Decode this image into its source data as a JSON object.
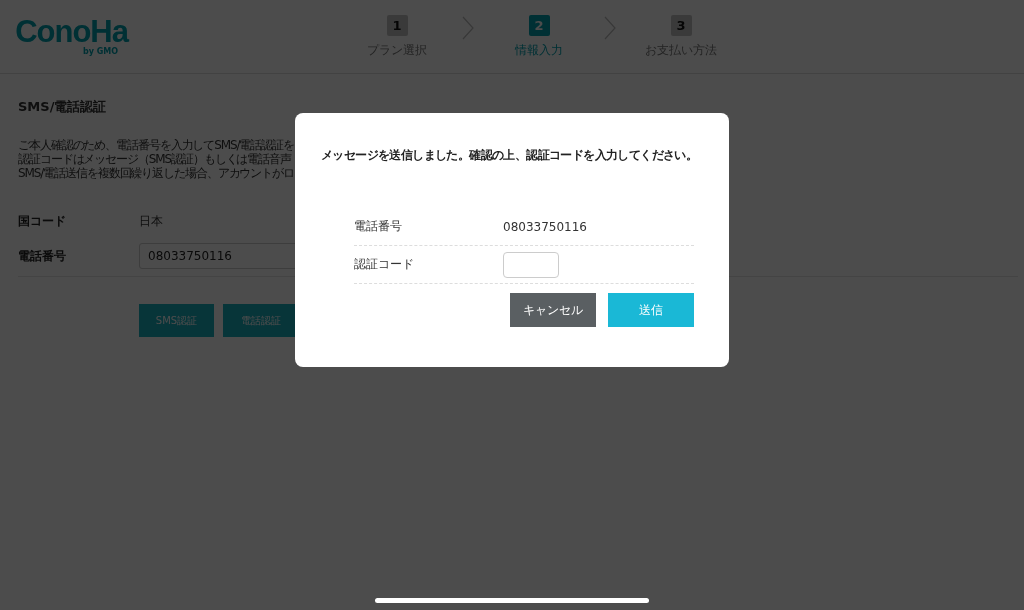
{
  "logo": {
    "name": "ConoHa",
    "byline": "by GMO"
  },
  "steps": [
    {
      "number": "1",
      "label": "プラン選択",
      "selected": false
    },
    {
      "number": "2",
      "label": "情報入力",
      "selected": true
    },
    {
      "number": "3",
      "label": "お支払い方法",
      "selected": false
    }
  ],
  "section": {
    "title": "SMS/電話認証",
    "description": [
      "ご本人確認のため、電話番号を入力してSMS/電話認証を",
      "認証コードはメッセージ（SMS認証）もしくは電話音声",
      "SMS/電話送信を複数回繰り返した場合、アカウントがロ"
    ],
    "fields": [
      {
        "label": "国コード",
        "value": "日本",
        "kind": "text"
      },
      {
        "label": "電話番号",
        "value": "08033750116",
        "kind": "input"
      }
    ],
    "buttons": [
      "SMS認証",
      "電話認証"
    ]
  },
  "dialog": {
    "message": "メッセージを送信しました。確認の上、認証コードを入力してください。",
    "rows": [
      {
        "label": "電話番号",
        "value": "08033750116",
        "kind": "text"
      },
      {
        "label": "認証コード",
        "kind": "input"
      }
    ],
    "buttons": [
      {
        "label": "キャンセル",
        "kind": "secondary"
      },
      {
        "label": "送信",
        "kind": "primary"
      }
    ]
  }
}
